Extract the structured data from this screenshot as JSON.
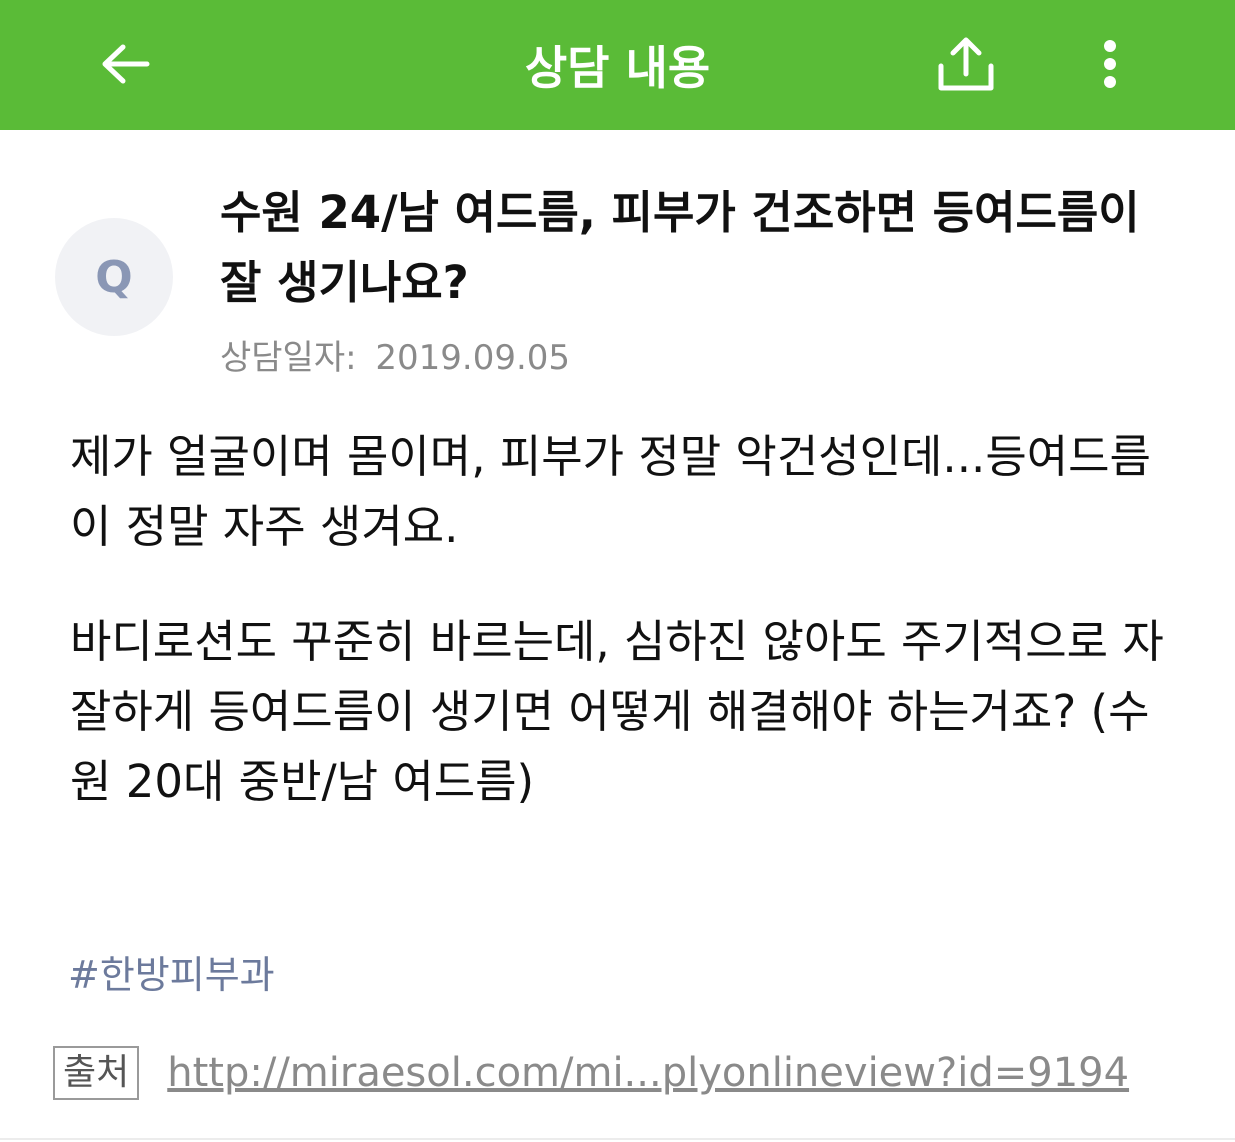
{
  "header": {
    "title": "상담 내용",
    "back_icon": "arrow-left-icon",
    "share_icon": "share-upload-icon",
    "more_icon": "more-vertical-icon",
    "bg_color": "#5abb37"
  },
  "question": {
    "avatar_letter": "Q",
    "title": "수원 24/남 여드름, 피부가 건조하면 등여드름이 잘 생기나요?",
    "date_label": "상담일자:",
    "date_value": "2019.09.05"
  },
  "body": {
    "paragraphs": [
      "제가 얼굴이며 몸이며, 피부가 정말 악건성인데...등여드름이 정말 자주 생겨요.",
      "바디로션도 꾸준히 바르는데, 심하진 않아도 주기적으로 자잘하게 등여드름이 생기면 어떻게 해결해야 하는거죠? (수원 20대 중반/남 여드름)"
    ]
  },
  "hashtag": "#한방피부과",
  "source": {
    "label": "출처",
    "link": "http://miraesol.com/mi...plyonlineview?id=9194"
  }
}
